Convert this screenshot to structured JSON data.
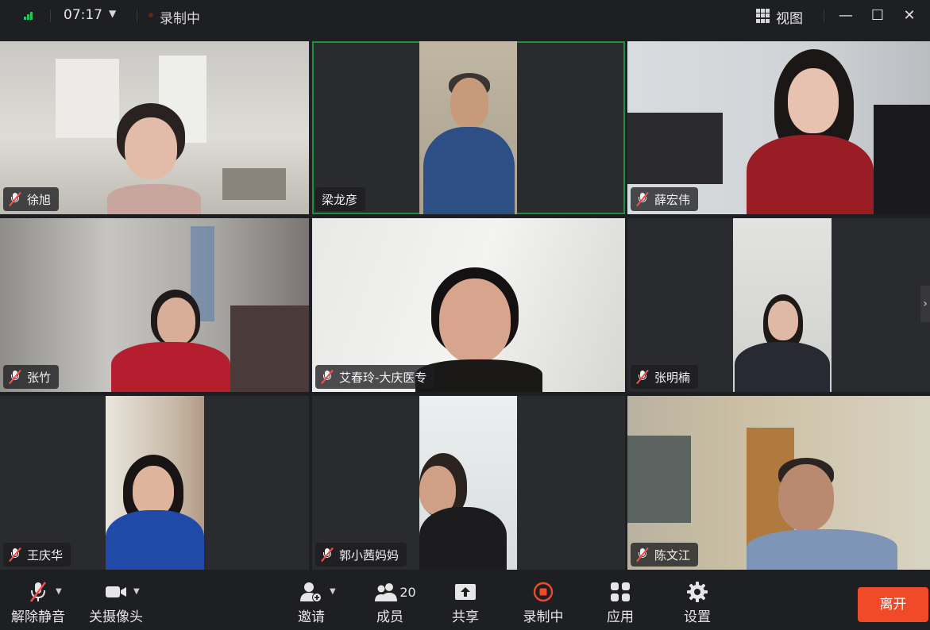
{
  "topbar": {
    "time": "07:17",
    "recording_label": "录制中",
    "view_label": "视图"
  },
  "participants": [
    {
      "name": "徐旭"
    },
    {
      "name": "梁龙彦"
    },
    {
      "name": "薛宏伟"
    },
    {
      "name": "张竹"
    },
    {
      "name": "艾春玲-大庆医专"
    },
    {
      "name": "张明楠"
    },
    {
      "name": "王庆华"
    },
    {
      "name": "郭小茜妈妈"
    },
    {
      "name": "陈文江"
    }
  ],
  "toolbar": {
    "unmute_label": "解除静音",
    "camera_label": "关摄像头",
    "invite_label": "邀请",
    "members_label": "成员",
    "members_count": "20",
    "share_label": "共享",
    "record_label": "录制中",
    "apps_label": "应用",
    "settings_label": "设置",
    "leave_label": "离开"
  },
  "colors": {
    "background": "#1e1f22",
    "active_speaker_border": "#1f8f3a",
    "leave_button": "#f04a28",
    "record_icon": "#f04a28",
    "signal": "#22c55e",
    "mic_muted_slash": "#ff4d4d"
  }
}
